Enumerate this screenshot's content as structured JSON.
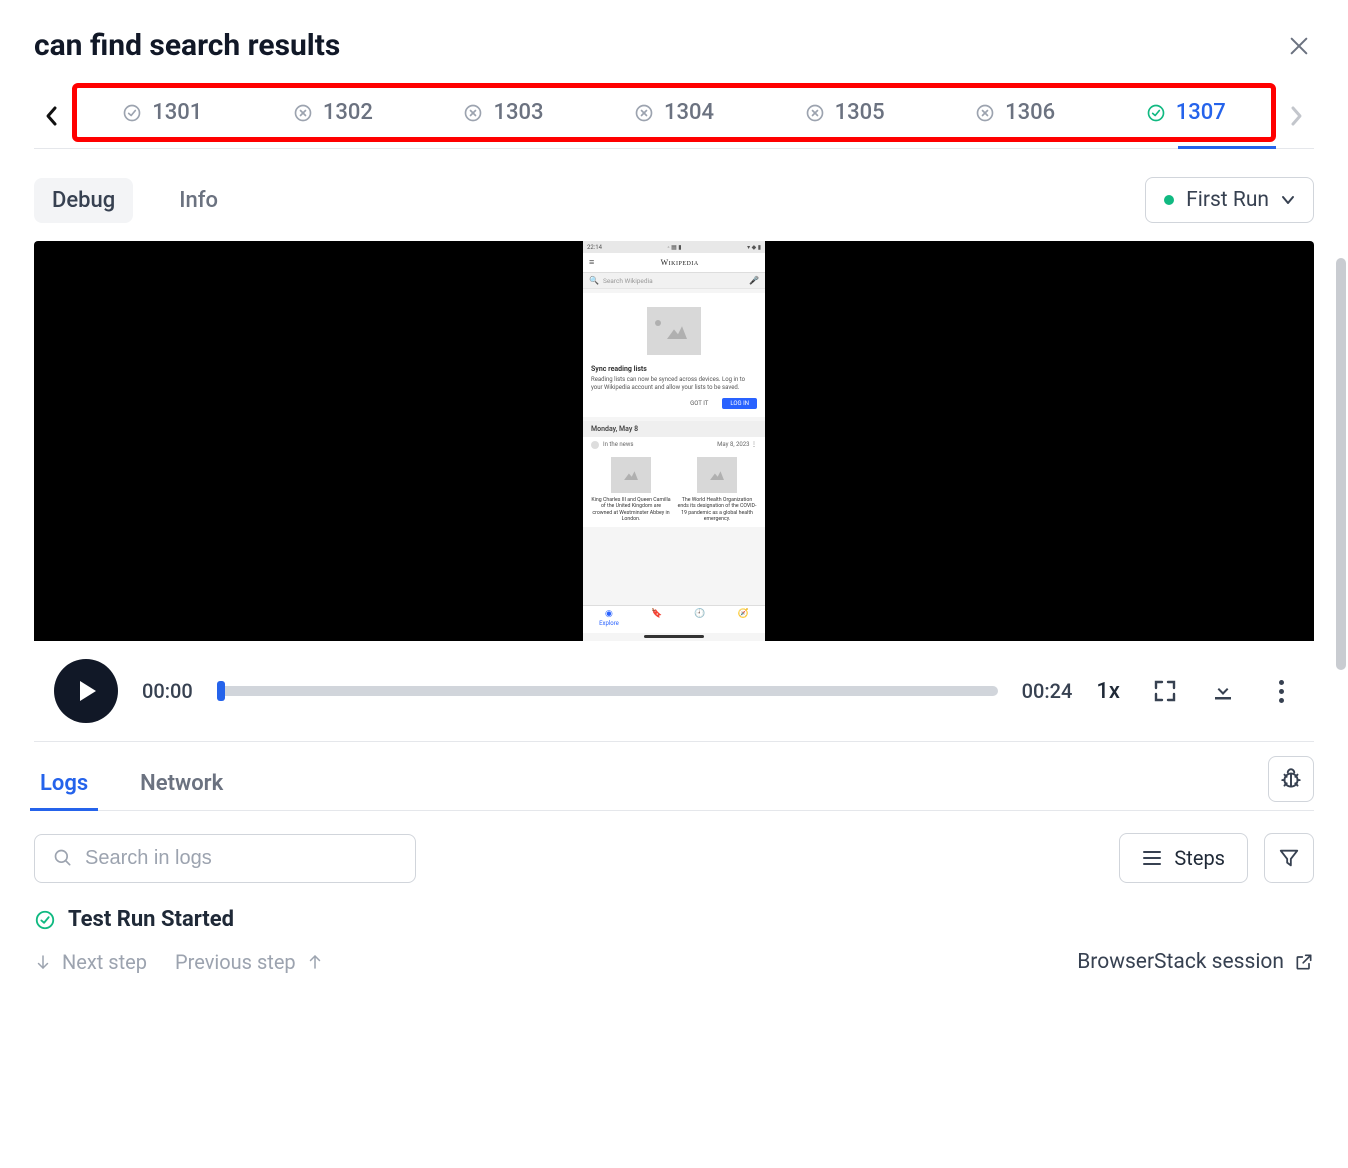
{
  "header": {
    "title": "can find search results"
  },
  "runs": [
    {
      "id": "1301",
      "status": "pass_gray"
    },
    {
      "id": "1302",
      "status": "fail"
    },
    {
      "id": "1303",
      "status": "fail"
    },
    {
      "id": "1304",
      "status": "fail"
    },
    {
      "id": "1305",
      "status": "fail"
    },
    {
      "id": "1306",
      "status": "fail"
    },
    {
      "id": "1307",
      "status": "pass_green",
      "active": true
    }
  ],
  "view_tabs": {
    "debug": "Debug",
    "info": "Info"
  },
  "run_select": {
    "label": "First Run"
  },
  "player": {
    "current": "00:00",
    "duration": "00:24",
    "speed": "1x"
  },
  "phone": {
    "time": "22:14",
    "app_title": "Wikipedia",
    "search_placeholder": "Search Wikipedia",
    "sync_card": {
      "title": "Sync reading lists",
      "body": "Reading lists can now be synced across devices. Log in to your Wikipedia account and allow your lists to be saved.",
      "got_it": "GOT IT",
      "log_in": "LOG IN"
    },
    "date_header": "Monday, May 8",
    "news": {
      "section": "In the news",
      "date": "May 8, 2023",
      "items": [
        "King Charles III and Queen Camilla of the United Kingdom are crowned at Westminster Abbey in London.",
        "The World Health Organization ends its designation of the COVID-19 pandemic as a global health emergency."
      ]
    },
    "nav": {
      "explore": "Explore"
    }
  },
  "logs": {
    "tab_logs": "Logs",
    "tab_network": "Network",
    "search_placeholder": "Search in logs",
    "steps_btn": "Steps",
    "first_entry": "Test Run Started"
  },
  "footer": {
    "next": "Next step",
    "prev": "Previous step",
    "session": "BrowserStack session"
  }
}
